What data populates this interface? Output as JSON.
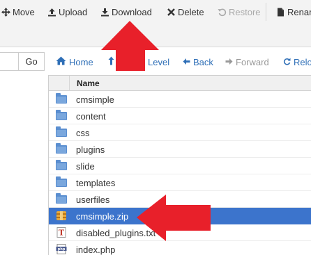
{
  "toolbar": {
    "move_label": "Move",
    "upload_label": "Upload",
    "download_label": "Download",
    "delete_label": "Delete",
    "restore_label": "Restore",
    "rename_label": "Renam"
  },
  "nav": {
    "go_label": "Go",
    "home_label": "Home",
    "up_level_label": "Level",
    "back_label": "Back",
    "forward_label": "Forward",
    "reload_label": "Relo"
  },
  "table": {
    "header_name": "Name",
    "rows": [
      {
        "name": "cmsimple",
        "type": "folder"
      },
      {
        "name": "content",
        "type": "folder"
      },
      {
        "name": "css",
        "type": "folder"
      },
      {
        "name": "plugins",
        "type": "folder"
      },
      {
        "name": "slide",
        "type": "folder"
      },
      {
        "name": "templates",
        "type": "folder"
      },
      {
        "name": "userfiles",
        "type": "folder"
      },
      {
        "name": "cmsimple.zip",
        "type": "archive",
        "selected": true
      },
      {
        "name": "disabled_plugins.txt",
        "type": "text"
      },
      {
        "name": "index.php",
        "type": "php"
      }
    ]
  },
  "colors": {
    "selection": "#3c74cc",
    "link": "#2f6fb7",
    "annotation_arrow": "#e8202a"
  }
}
